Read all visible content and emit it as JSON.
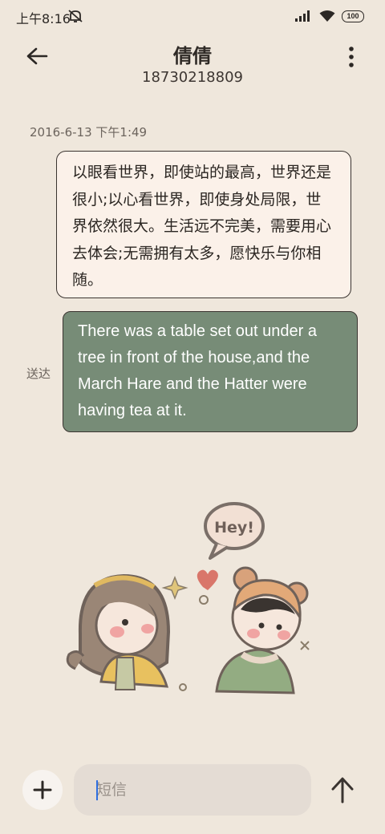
{
  "status_bar": {
    "time": "上午8:16",
    "battery": "100",
    "icons": [
      "mute-icon",
      "signal-icon",
      "wifi-icon",
      "battery-icon"
    ]
  },
  "header": {
    "contact_name": "倩倩",
    "phone_number": "18730218809",
    "icons": [
      "back-arrow-icon",
      "more-vertical-icon"
    ]
  },
  "conversation": {
    "timestamp": "2016-6-13 下午1:49",
    "messages": [
      {
        "direction": "received",
        "text": "以眼看世界，即使站的最高，世界还是很小;以心看世界，即使身处局限，世界依然很大。生活远不完美，需要用心去体会;无需拥有太多，愿快乐与你相随。"
      },
      {
        "direction": "sent",
        "text": "There was a table set out under a tree in front of the house,and the March Hare and the Hatter were having tea at it.",
        "status": "送达"
      }
    ],
    "sticker": {
      "speech_text": "Hey!",
      "icon": "couple-sticker"
    }
  },
  "input_bar": {
    "placeholder": "短信",
    "value": "",
    "icons": [
      "plus-icon",
      "send-arrow-icon"
    ]
  },
  "colors": {
    "background": "#efe7dc",
    "received_bubble": "#fbf1e9",
    "sent_bubble": "#778c77",
    "input_background": "#e4dcd4"
  }
}
